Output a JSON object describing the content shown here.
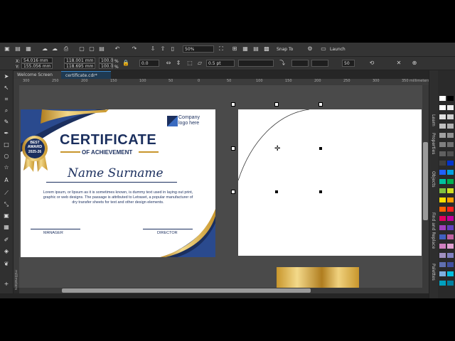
{
  "toolbar": {
    "zoom": "50%",
    "snap_to": "Snap To",
    "launch": "Launch"
  },
  "property_bar": {
    "x": "54.016 mm",
    "y": "155.056 mm",
    "width": "118.001 mm",
    "height": "118.695 mm",
    "scale_x": "100.0",
    "scale_y": "100.0",
    "scale_unit": "%",
    "rotation": "0.0",
    "outline": "0.5 pt",
    "value": "50"
  },
  "tabs": {
    "welcome": "Welcome Screen",
    "document": "certificate.cdr*"
  },
  "ruler": {
    "units": "millimeters",
    "v_units": "millimeters",
    "ticks": [
      "300",
      "250",
      "200",
      "150",
      "100",
      "50",
      "0",
      "50",
      "100",
      "150",
      "200",
      "250",
      "300",
      "350"
    ]
  },
  "dockers": [
    "Learn",
    "Properties",
    "Objects",
    "Find and Replace",
    "Palettes"
  ],
  "certificate": {
    "badge_line1": "BEST",
    "badge_line2": "AWARD",
    "badge_line3": "2025-26",
    "company_line1": "Company",
    "company_line2": "logo here",
    "title": "CERTIFICATE",
    "subtitle": "OF ACHIEVEMENT",
    "name": "Name Surname",
    "body": "Lorem ipsum, or lipsum as it is sometimes known, is dummy text used in laying out print, graphic or web designs. The passage is attributed to Letraset, a popular manufacturer of dry transfer sheets for text and other design elements.",
    "manager": "MANAGER",
    "director": "DIRECTOR"
  },
  "colors": {
    "navy": "#1b2f5e",
    "gold": "#c8962c",
    "palette": [
      "#ffffff",
      "#000000",
      "#ffffff",
      "#eeeeee",
      "#e0e0e0",
      "#d0d0d0",
      "#c0c0c0",
      "#b0b0b0",
      "#a0a0a0",
      "#909090",
      "#808080",
      "#707070",
      "#606060",
      "#505050",
      "#404040",
      "#0033cc",
      "#2060ff",
      "#00a0e0",
      "#00c0a0",
      "#00b050",
      "#80c040",
      "#d0e020",
      "#ffe000",
      "#ffa000",
      "#ff6000",
      "#ff2020",
      "#e00060",
      "#c000a0",
      "#a040c0",
      "#6040c0",
      "#4060c0",
      "#c060a0",
      "#d080c0",
      "#e0a0d0",
      "#a090c0",
      "#8080c0",
      "#6070b0",
      "#4050a0",
      "#80b0e0",
      "#00c0e0",
      "#00a0c0",
      "#0080a0"
    ]
  }
}
